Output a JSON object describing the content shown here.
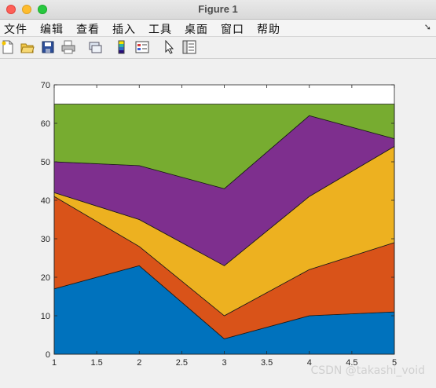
{
  "window": {
    "title": "Figure 1"
  },
  "menu": {
    "items": [
      "文件",
      "编辑",
      "查看",
      "插入",
      "工具",
      "桌面",
      "窗口",
      "帮助"
    ]
  },
  "toolbar": {
    "buttons": [
      "new-figure-icon",
      "open-file-icon",
      "save-icon",
      "print-icon",
      "link-icon",
      "colorbar-icon",
      "legend-icon",
      "pointer-icon",
      "property-editor-icon"
    ]
  },
  "watermark": "CSDN @takashi_void",
  "chart_data": {
    "type": "area",
    "title": "",
    "xlabel": "",
    "ylabel": "",
    "stacked": true,
    "x": [
      1,
      2,
      3,
      4,
      5
    ],
    "xlim": [
      1,
      5
    ],
    "ylim": [
      0,
      70
    ],
    "xticks": [
      "1",
      "1.5",
      "2",
      "2.5",
      "3",
      "3.5",
      "4",
      "4.5",
      "5"
    ],
    "yticks": [
      "0",
      "10",
      "20",
      "30",
      "40",
      "50",
      "60",
      "70"
    ],
    "grid": false,
    "series": [
      {
        "values": [
          17,
          23,
          4,
          10,
          11
        ],
        "color": "#0072bd"
      },
      {
        "values": [
          24,
          5,
          6,
          12,
          18
        ],
        "color": "#d95319"
      },
      {
        "values": [
          1,
          7,
          13,
          19,
          25
        ],
        "color": "#edb120"
      },
      {
        "values": [
          8,
          14,
          20,
          21,
          2
        ],
        "color": "#7e2f8e"
      },
      {
        "values": [
          15,
          16,
          22,
          3,
          9
        ],
        "color": "#77ac30"
      }
    ]
  }
}
